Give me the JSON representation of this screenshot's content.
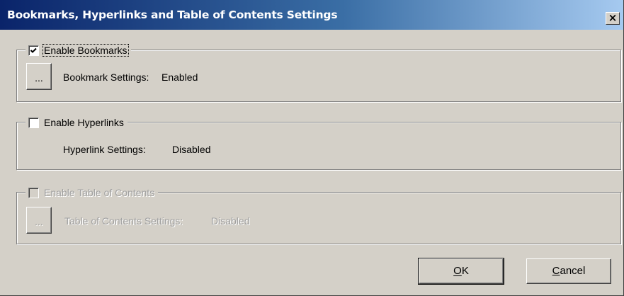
{
  "window": {
    "title": "Bookmarks, Hyperlinks and Table of Contents Settings",
    "close_glyph": "×"
  },
  "groups": {
    "bookmarks": {
      "checkbox_label": "Enable Bookmarks",
      "checked": true,
      "enabled": true,
      "button_label": "...",
      "setting_label": "Bookmark Settings:",
      "setting_value": "Enabled"
    },
    "hyperlinks": {
      "checkbox_label": "Enable Hyperlinks",
      "checked": false,
      "enabled": true,
      "setting_label": "Hyperlink Settings:",
      "setting_value": "Disabled"
    },
    "toc": {
      "checkbox_label": "Enable Table of Contents",
      "checked": false,
      "enabled": false,
      "button_label": "...",
      "setting_label": "Table of Contents Settings:",
      "setting_value": "Disabled"
    }
  },
  "buttons": {
    "ok_label": "OK",
    "cancel_label": "Cancel"
  },
  "icons": {
    "close": "close-icon",
    "check": "checkmark-icon"
  },
  "colors": {
    "face": "#d4d0c8",
    "title_start": "#0a246a",
    "title_end": "#a6caf0",
    "disabled_text": "#a0a0a0"
  }
}
